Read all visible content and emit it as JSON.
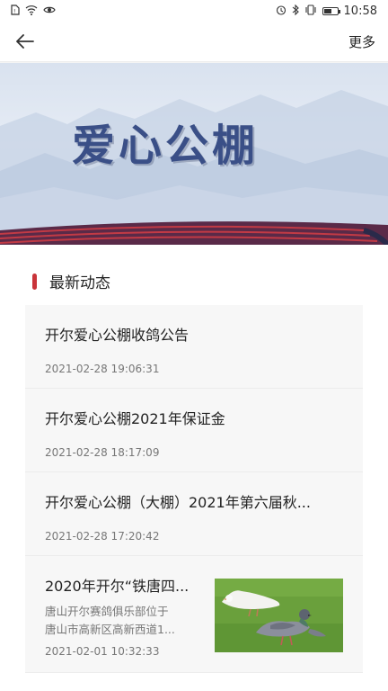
{
  "status_bar": {
    "time": "10:58",
    "left_icons": [
      "sim-icon",
      "wifi-icon",
      "eye-icon"
    ],
    "right_icons": [
      "alarm-icon",
      "bluetooth-icon",
      "vibrate-icon",
      "battery-icon"
    ],
    "battery_level": 0.55
  },
  "nav": {
    "back_icon": "arrow-left-icon",
    "more_label": "更多"
  },
  "banner": {
    "title": "爱心公棚"
  },
  "section": {
    "title": "最新动态"
  },
  "news": [
    {
      "title": "开尔爱心公棚收鸽公告",
      "time": "2021-02-28 19:06:31"
    },
    {
      "title": "开尔爱心公棚2021年保证金",
      "time": "2021-02-28 18:17:09"
    },
    {
      "title": "开尔爱心公棚（大棚）2021年第六届秋...",
      "time": "2021-02-28 17:20:42"
    },
    {
      "title": "2020年开尔“铁唐四...",
      "summary_line1": "唐山开尔赛鸽俱乐部位于",
      "summary_line2": "唐山市高新区高新西道1...",
      "time": "2021-02-01 10:32:33",
      "thumbnail": "pigeons-on-grass-image"
    }
  ]
}
